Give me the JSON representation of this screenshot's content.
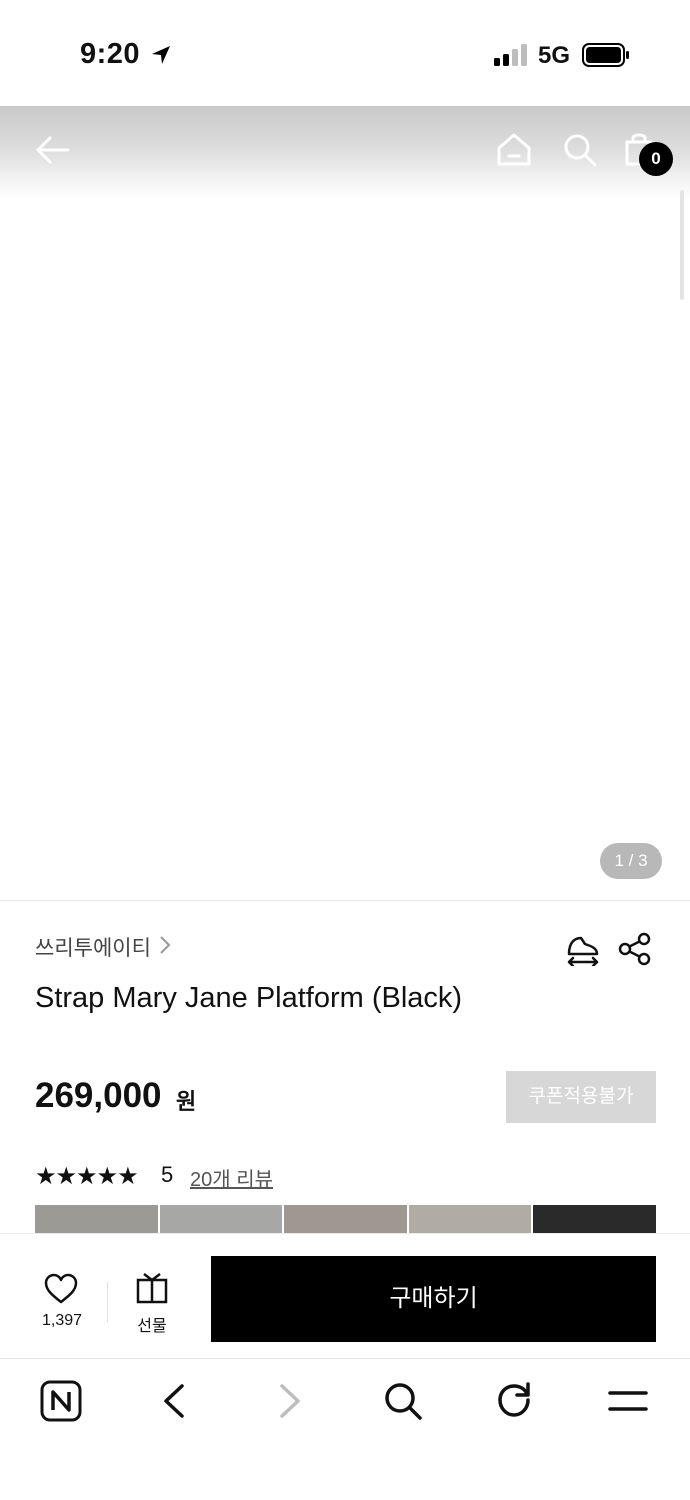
{
  "status_bar": {
    "time": "9:20",
    "network": "5G"
  },
  "top_nav": {
    "cart_count": "0"
  },
  "gallery": {
    "pager": "1 / 3"
  },
  "product": {
    "brand": "쓰리투에이티",
    "title": "Strap Mary Jane Platform (Black)",
    "price": "269,000",
    "currency": "원",
    "coupon_label": "쿠폰적용불가",
    "stars": "★★★★★",
    "rating": "5",
    "review_link": "20개 리뷰"
  },
  "purchase_bar": {
    "like_count": "1,397",
    "gift_label": "선물",
    "buy_label": "구매하기"
  },
  "colors": {
    "accent": "#000000",
    "disabled": "#d7d7d7"
  }
}
